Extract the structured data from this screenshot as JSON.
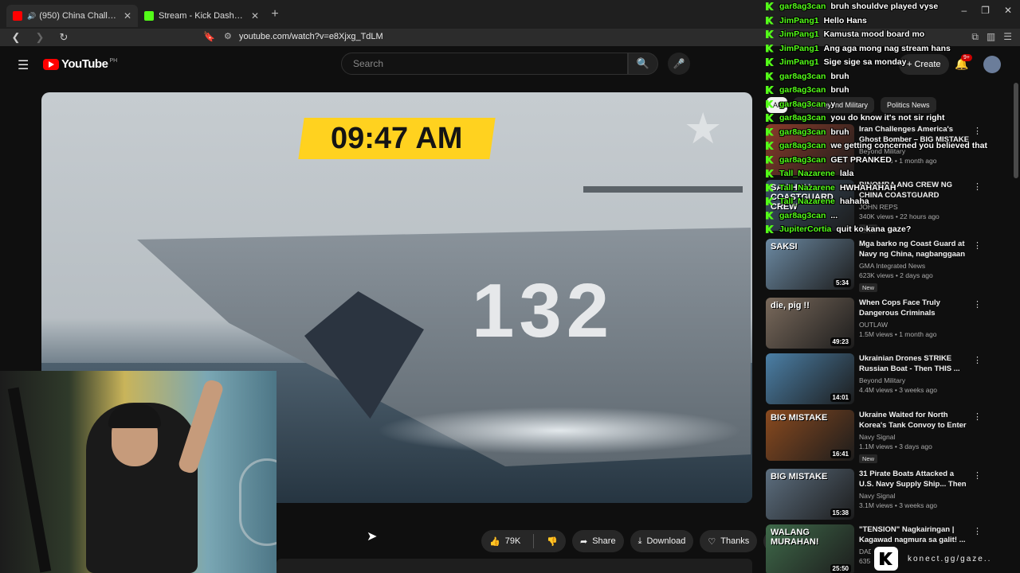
{
  "browser": {
    "tabs": [
      {
        "title": "(950) China Challenged US N",
        "active": true
      },
      {
        "title": "Stream - Kick Dashboard",
        "active": false
      }
    ],
    "new_tab_icon": "+",
    "url": "youtube.com/watch?v=e8Xjxg_TdLM",
    "window_controls": [
      "–",
      "❐",
      "✕"
    ]
  },
  "youtube": {
    "logo_text": "YouTube",
    "country_code": "PH",
    "search_placeholder": "Search",
    "create_label": "Create",
    "notification_badge": "9+"
  },
  "video": {
    "overlay_time": "09:47 AM",
    "hull_number": "132"
  },
  "actions": {
    "likes": "79K",
    "share": "Share",
    "download": "Download",
    "thanks": "Thanks"
  },
  "chips": [
    {
      "label": "All",
      "selected": true
    },
    {
      "label": "From Beyond Military",
      "selected": false
    },
    {
      "label": "Politics News",
      "selected": false
    }
  ],
  "recommendations": [
    {
      "title": "Iran Challenges America's Ghost Bomber – BIG MISTAKE",
      "channel": "Beyond Military",
      "meta": "4.6M views • 1 month ago",
      "duration": "",
      "thumb_text": "",
      "new": false,
      "thumb_color": "#8a3b2a"
    },
    {
      "title": "BINOMBA ANG CREW NG CHINA COASTGUARD NASAWI SA ...",
      "channel": "JOHN REPS",
      "meta": "340K views • 22 hours ago",
      "duration": "",
      "thumb_text": "SA CHINA COASTGUARD CREW",
      "new": true,
      "thumb_color": "#3a4f63"
    },
    {
      "title": "Mga barko ng Coast Guard at Navy ng China, nagbanggaan ...",
      "channel": "GMA Integrated News",
      "meta": "623K views • 2 days ago",
      "duration": "5:34",
      "thumb_text": "SAKSI",
      "new": true,
      "thumb_color": "#6c8aa3"
    },
    {
      "title": "When Cops Face Truly Dangerous Criminals",
      "channel": "OUTLAW",
      "meta": "1.5M views • 1 month ago",
      "duration": "49:23",
      "thumb_text": "die, pig !!",
      "new": false,
      "thumb_color": "#7a6a5c"
    },
    {
      "title": "Ukrainian Drones STRIKE Russian Boat - Then THIS ...",
      "channel": "Beyond Military",
      "meta": "4.4M views • 3 weeks ago",
      "duration": "14:01",
      "thumb_text": "",
      "new": false,
      "thumb_color": "#4b7fa6"
    },
    {
      "title": "Ukraine Waited for North Korea's Tank Convoy to Enter ...",
      "channel": "Navy Signal",
      "meta": "1.1M views • 3 days ago",
      "duration": "16:41",
      "thumb_text": "BIG MISTAKE",
      "new": true,
      "thumb_color": "#8a4a1f"
    },
    {
      "title": "31 Pirate Boats Attacked a U.S. Navy Supply Ship... Then This ...",
      "channel": "Navy Signal",
      "meta": "3.1M views • 3 weeks ago",
      "duration": "15:38",
      "thumb_text": "BIG MISTAKE",
      "new": false,
      "thumb_color": "#5d6f80"
    },
    {
      "title": "\"TENSION\" Nagkairingan | Kagawad nagmura sa galit! ...",
      "channel": "DAD",
      "meta": "635",
      "duration": "25:50",
      "thumb_text": "WALANG MURAHAN!",
      "new": false,
      "thumb_color": "#3f6a4a"
    }
  ],
  "chat": [
    {
      "user": "gar8ag3can",
      "text": "bruh shouldve played vyse"
    },
    {
      "user": "JimPang1",
      "text": "Hello Hans"
    },
    {
      "user": "JimPang1",
      "text": "Kamusta mood board mo"
    },
    {
      "user": "JimPang1",
      "text": "Ang aga mong nag stream hans"
    },
    {
      "user": "JimPang1",
      "text": "Sige sige sa monday"
    },
    {
      "user": "gar8ag3can",
      "text": "bruh"
    },
    {
      "user": "gar8ag3can",
      "text": "bruh"
    },
    {
      "user": "gar8ag3can",
      "text": "y"
    },
    {
      "user": "gar8ag3can",
      "text": "you do know it's not sir right"
    },
    {
      "user": "gar8ag3can",
      "text": "bruh"
    },
    {
      "user": "gar8ag3can",
      "text": "we getting concerned you believed that"
    },
    {
      "user": "gar8ag3can",
      "text": "GET PRANKED"
    },
    {
      "user": "Tall_Nazarene",
      "text": "lala"
    },
    {
      "user": "Tall_Nazarene",
      "text": "HWHAHAHAH"
    },
    {
      "user": "Tall_Nazarene",
      "text": "hahaha"
    },
    {
      "user": "gar8ag3can",
      "text": "..."
    },
    {
      "user": "JupiterCortia",
      "text": "quit ko kana gaze?"
    }
  ],
  "kick_watermark": "konect.gg/gaze.."
}
